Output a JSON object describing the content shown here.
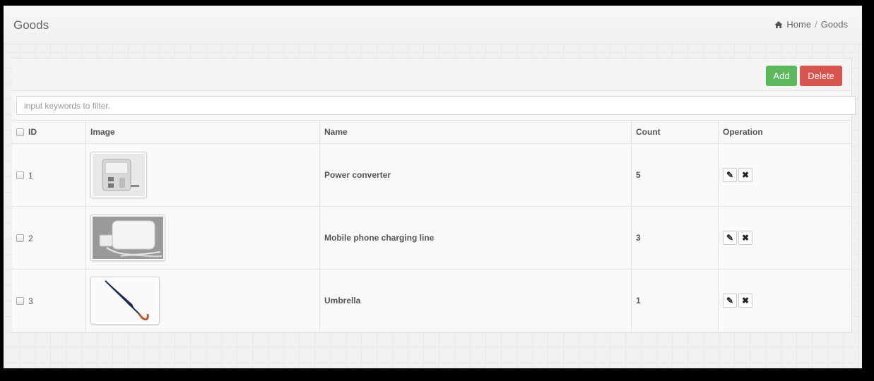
{
  "header": {
    "title": "Goods"
  },
  "breadcrumb": {
    "home": "Home",
    "separator": "/",
    "current": "Goods"
  },
  "toolbar": {
    "add_label": "Add",
    "delete_label": "Delete"
  },
  "filter": {
    "placeholder": "input keywords to filter.",
    "value": ""
  },
  "table": {
    "columns": {
      "id": "ID",
      "image": "Image",
      "name": "Name",
      "count": "Count",
      "operation": "Operation"
    },
    "rows": [
      {
        "id": "1",
        "image": "power-converter-photo",
        "name": "Power converter",
        "count": "5"
      },
      {
        "id": "2",
        "image": "charger-photo",
        "name": "Mobile phone charging line",
        "count": "3"
      },
      {
        "id": "3",
        "image": "umbrella-photo",
        "name": "Umbrella",
        "count": "1"
      }
    ]
  },
  "icons": {
    "home": "home-icon",
    "edit": "pencil-icon",
    "delete": "cross-icon"
  },
  "colors": {
    "add": "#5cb85c",
    "delete": "#d9534f"
  }
}
